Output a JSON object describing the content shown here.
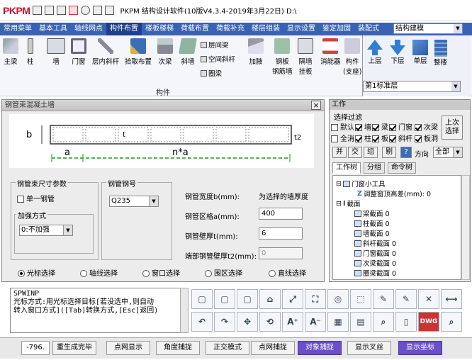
{
  "titlebar": {
    "logo": "PKPM",
    "title": "PKPM 结构设计软件(10版V4.3.4-2019年3月22日) D:\\"
  },
  "menu": [
    "常用菜单",
    "基本工具",
    "轴线网点",
    "构件布置",
    "楼板楼梯",
    "荷载布置",
    "荷载补充",
    "楼层组装",
    "显示设置",
    "鉴定加固",
    "装配式"
  ],
  "menu_active": 3,
  "struct_combo": "结构建模",
  "ribbon": {
    "buttons": [
      "主梁",
      "柱",
      "墙",
      "门窗",
      "层内斜杆",
      "拾取布置",
      "次梁",
      "斜墙"
    ],
    "small": [
      "层间梁",
      "空间斜杆",
      "圈梁"
    ],
    "buttons2": [
      "加腋",
      "钢板\n钢筋墙",
      "隔墙\n挂板",
      "消能器",
      "构件\n(支座)"
    ],
    "group_label": "构件"
  },
  "view": {
    "buttons": [
      "上层",
      "下层",
      "单层",
      "整楼"
    ],
    "side": "上次\n选择",
    "floor": "第1标准层"
  },
  "dialog": {
    "title": "钢管束混凝土墙",
    "diagram": {
      "b": "b",
      "t": "t",
      "t2": "t2",
      "a": "a",
      "na": "n*a"
    },
    "group_size": "钢管束尺寸参数",
    "single_tube": "单一钢管",
    "reinforce_label": "加强方式",
    "reinforce_value": "0:不加强",
    "steel_label": "钢管钢号",
    "steel_value": "Q235",
    "width_label": "钢管宽度b(mm):",
    "width_value": "为选择的墙厚度",
    "spacing_label": "钢管区格a(mm):",
    "spacing_value": "400",
    "thick_label": "钢管壁厚t(mm):",
    "thick_value": "6",
    "end_label": "端部钢管壁厚t2(mm):",
    "end_value": "0",
    "radios": [
      "光标选择",
      "轴线选择",
      "窗口选择",
      "围区选择",
      "直线选择"
    ]
  },
  "work": {
    "title": "工作",
    "filter": "选择过滤",
    "checks": [
      [
        "默认",
        "墙",
        "梁",
        "门窗",
        "次梁"
      ],
      [
        "全消",
        "柱",
        "板",
        "斜杆",
        "板洞"
      ]
    ],
    "buttons": [
      "并",
      "交",
      "组",
      "剔",
      "?",
      "方向"
    ],
    "all": "全部",
    "tabs": [
      "工作树",
      "分组",
      "命令树"
    ],
    "tree": [
      "门窗小工具",
      "调整窗顶高差(mm): 0",
      "截面",
      "梁截面 0",
      "柱截面 0",
      "墙截面 0",
      "斜杆截面 0",
      "门窗截面 0",
      "次梁截面 0",
      "圈梁截面 0"
    ]
  },
  "cmd": [
    "SPWINP",
    "光标方式:用光标选择目标[若没选中,则自动",
    "转入窗口方式]([Tab]转换方式,[Esc]返回)"
  ],
  "status": [
    "-796.",
    "重生成完毕",
    "点网显示",
    "角度捕捉",
    "正交模式",
    "点网捕捉",
    "对象捕捉",
    "显示叉丝",
    "显示坐标"
  ],
  "status_on": [
    6,
    8
  ]
}
